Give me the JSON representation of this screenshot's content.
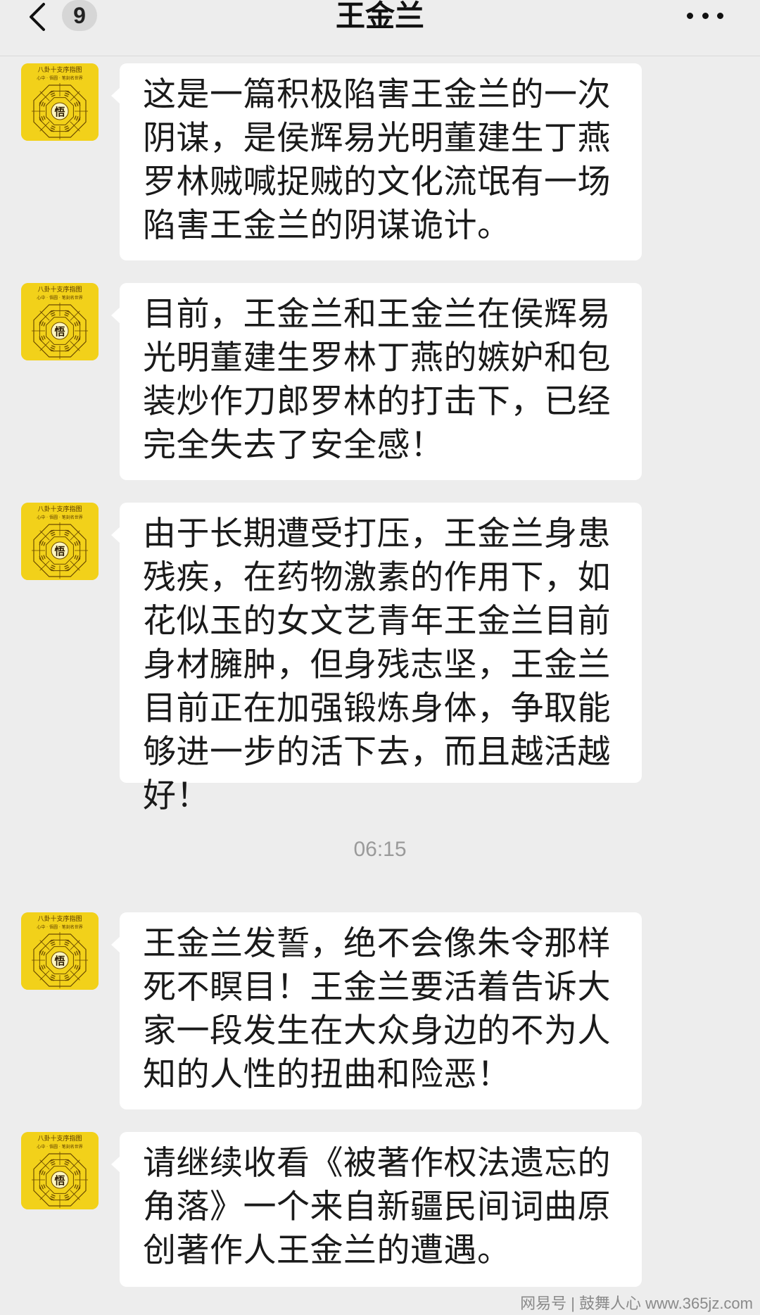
{
  "header": {
    "unread_count": "9",
    "title": "王金兰"
  },
  "avatar": {
    "top_text": "八卦十支序指图",
    "sub_text": "心中 · 悟圆 · 笔刻名世界",
    "center_char": "悟",
    "accent": "#f2d11a"
  },
  "messages": [
    {
      "text": "这是一篇积极陷害王金兰的一次阴谋，是侯辉易光明董建生丁燕罗林贼喊捉贼的文化流氓有一场陷害王金兰的阴谋诡计。"
    },
    {
      "text": "目前，王金兰和王金兰在侯辉易光明董建生罗林丁燕的嫉妒和包装炒作刀郎罗林的打击下，已经完全失去了安全感！"
    },
    {
      "text": "由于长期遭受打压，王金兰身患残疾，在药物激素的作用下，如花似玉的女文艺青年王金兰目前身材臃肿，但身残志坚，王金兰目前正在加强锻炼身体，争取能够进一步的活下去，而且越活越好！"
    },
    {
      "text": "王金兰发誓，绝不会像朱令那样死不瞑目！王金兰要活着告诉大家一段发生在大众身边的不为人知的人性的扭曲和险恶！"
    },
    {
      "text": "请继续收看《被著作权法遗忘的角落》一个来自新疆民间词曲原创著作人王金兰的遭遇。"
    }
  ],
  "timestamp": "06:15",
  "watermark": "网易号 | 鼓舞人心 www.365jz.com"
}
